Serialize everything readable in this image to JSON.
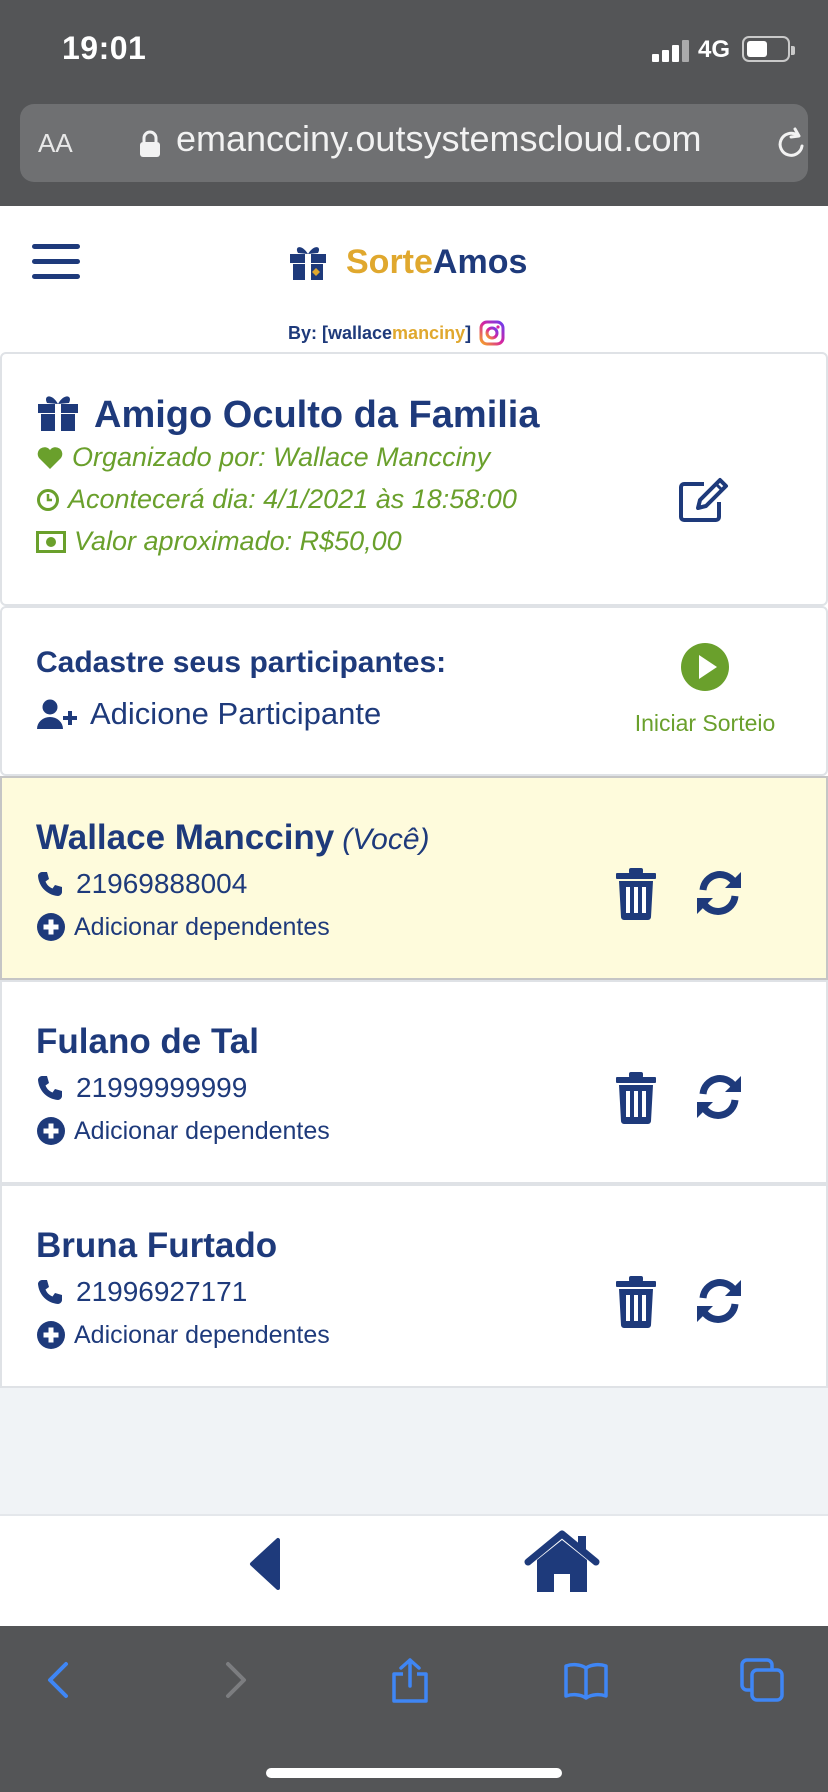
{
  "status": {
    "time": "19:01",
    "network": "4G"
  },
  "browser": {
    "text_size_label": "AA",
    "url": "emancciny.outsystemscloud.com"
  },
  "header": {
    "logo_part1": "Sorte",
    "logo_part2": "Amos",
    "by_prefix": "By: [wallace",
    "by_accent": "manciny",
    "by_suffix": "]"
  },
  "event": {
    "title": "Amigo Oculto da Familia",
    "organizer": "Organizado por: Wallace Mancciny",
    "date": "Acontecerá dia: 4/1/2021 às 18:58:00",
    "value": "Valor aproximado: R$50,00"
  },
  "register": {
    "title": "Cadastre seus participantes:",
    "add_label": "Adicione Participante",
    "start_label": "Iniciar Sorteio"
  },
  "participants": [
    {
      "name": "Wallace Mancciny",
      "tag": "(Você)",
      "phone": "21969888004",
      "dependents_label": "Adicionar dependentes"
    },
    {
      "name": "Fulano de Tal",
      "phone": "21999999999",
      "dependents_label": "Adicionar dependentes"
    },
    {
      "name": "Bruna Furtado",
      "phone": "21996927171",
      "dependents_label": "Adicionar dependentes"
    }
  ],
  "colors": {
    "primary": "#1e3a7b",
    "accent": "#e0a82e",
    "success": "#6aa02c",
    "highlight": "#fefbdc"
  },
  "icons": [
    "menu-icon",
    "gift-icon",
    "instagram-icon",
    "heart-icon",
    "clock-icon",
    "money-icon",
    "edit-icon",
    "user-plus-icon",
    "play-icon",
    "phone-icon",
    "plus-circle-icon",
    "trash-icon",
    "refresh-icon",
    "back-icon",
    "home-icon"
  ]
}
